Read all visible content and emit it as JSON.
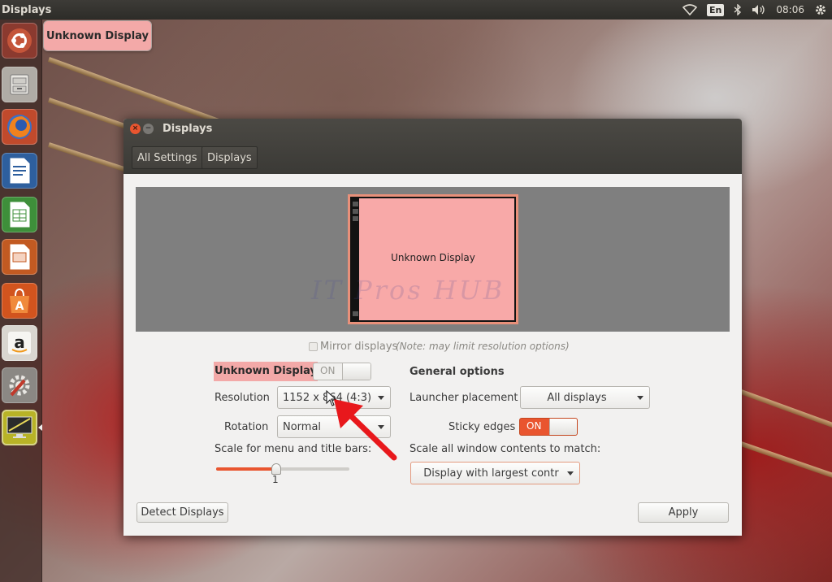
{
  "top_panel": {
    "title": "Displays",
    "keyboard_layout": "En",
    "clock": "08:06",
    "icons": [
      "wifi-icon",
      "bluetooth-icon",
      "volume-icon",
      "session-gear-icon"
    ]
  },
  "launcher": {
    "items": [
      {
        "name": "ubuntu-dash",
        "icon": "ubuntu-logo-icon"
      },
      {
        "name": "files",
        "icon": "file-cabinet-icon"
      },
      {
        "name": "firefox",
        "icon": "firefox-icon"
      },
      {
        "name": "writer",
        "icon": "writer-document-icon"
      },
      {
        "name": "calc",
        "icon": "calc-spreadsheet-icon"
      },
      {
        "name": "impress",
        "icon": "impress-presentation-icon"
      },
      {
        "name": "software-center",
        "icon": "shopping-bag-icon"
      },
      {
        "name": "amazon",
        "icon": "amazon-icon"
      },
      {
        "name": "system-settings",
        "icon": "wrench-gear-icon"
      },
      {
        "name": "displays",
        "icon": "display-monitor-icon"
      }
    ],
    "tooltip": "Unknown Display"
  },
  "window": {
    "title": "Displays",
    "breadcrumbs": [
      "All Settings",
      "Displays"
    ]
  },
  "preview": {
    "monitor_label": "Unknown Display",
    "watermark": "IT Pros HUB",
    "monitor_color": "#f8a9a8"
  },
  "mirror": {
    "label": "Mirror displays",
    "note": "(Note: may limit resolution options)",
    "checked": false
  },
  "display_settings": {
    "name": "Unknown Display",
    "switch_label": "ON",
    "resolution_label": "Resolution",
    "resolution_value": "1152 x 864 (4:3)",
    "rotation_label": "Rotation",
    "rotation_value": "Normal",
    "scale_label": "Scale for menu and title bars:",
    "scale_value": "1",
    "scale_fraction": 0.45
  },
  "general_options": {
    "heading": "General options",
    "launcher_placement_label": "Launcher placement",
    "launcher_placement_value": "All displays",
    "sticky_edges_label": "Sticky edges",
    "sticky_edges_state": "ON",
    "scale_all_label": "Scale all window contents to match:",
    "scale_all_value": "Display with largest contr"
  },
  "footer": {
    "detect_label": "Detect Displays",
    "apply_label": "Apply"
  },
  "colors": {
    "accent_orange": "#e9552f",
    "highlight_pink": "#f3a9a8",
    "annotation_red": "#e8181c"
  }
}
